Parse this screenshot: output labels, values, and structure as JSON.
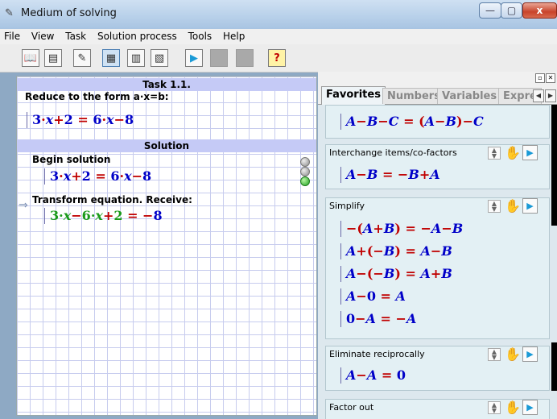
{
  "window": {
    "title": "Medium of solving",
    "minimize": "—",
    "maximize": "▢",
    "close": "x"
  },
  "menu": [
    "File",
    "View",
    "Task",
    "Solution process",
    "Tools",
    "Help"
  ],
  "toolbar": {
    "help": "?"
  },
  "task": {
    "title": "Task 1.1.",
    "instruction": "Reduce to the form a·x=b:"
  },
  "solution": {
    "header": "Solution",
    "step1": "Begin solution",
    "step2": "Transform equation. Receive:"
  },
  "panel": {
    "tabs": [
      "Favorites",
      "Numbers",
      "Variables",
      "Expre"
    ],
    "sections": [
      {
        "title": "Interchange items/co-factors"
      },
      {
        "title": "Simplify"
      },
      {
        "title": "Eliminate reciprocally"
      },
      {
        "title": "Factor out"
      }
    ]
  },
  "colors": {
    "grid": "#c7ccee",
    "band": "#c5caf6",
    "formula_blue": "#0000c8",
    "formula_red": "#c00000",
    "formula_green": "#1a9a1a",
    "panel_bg": "#dde8ee"
  }
}
